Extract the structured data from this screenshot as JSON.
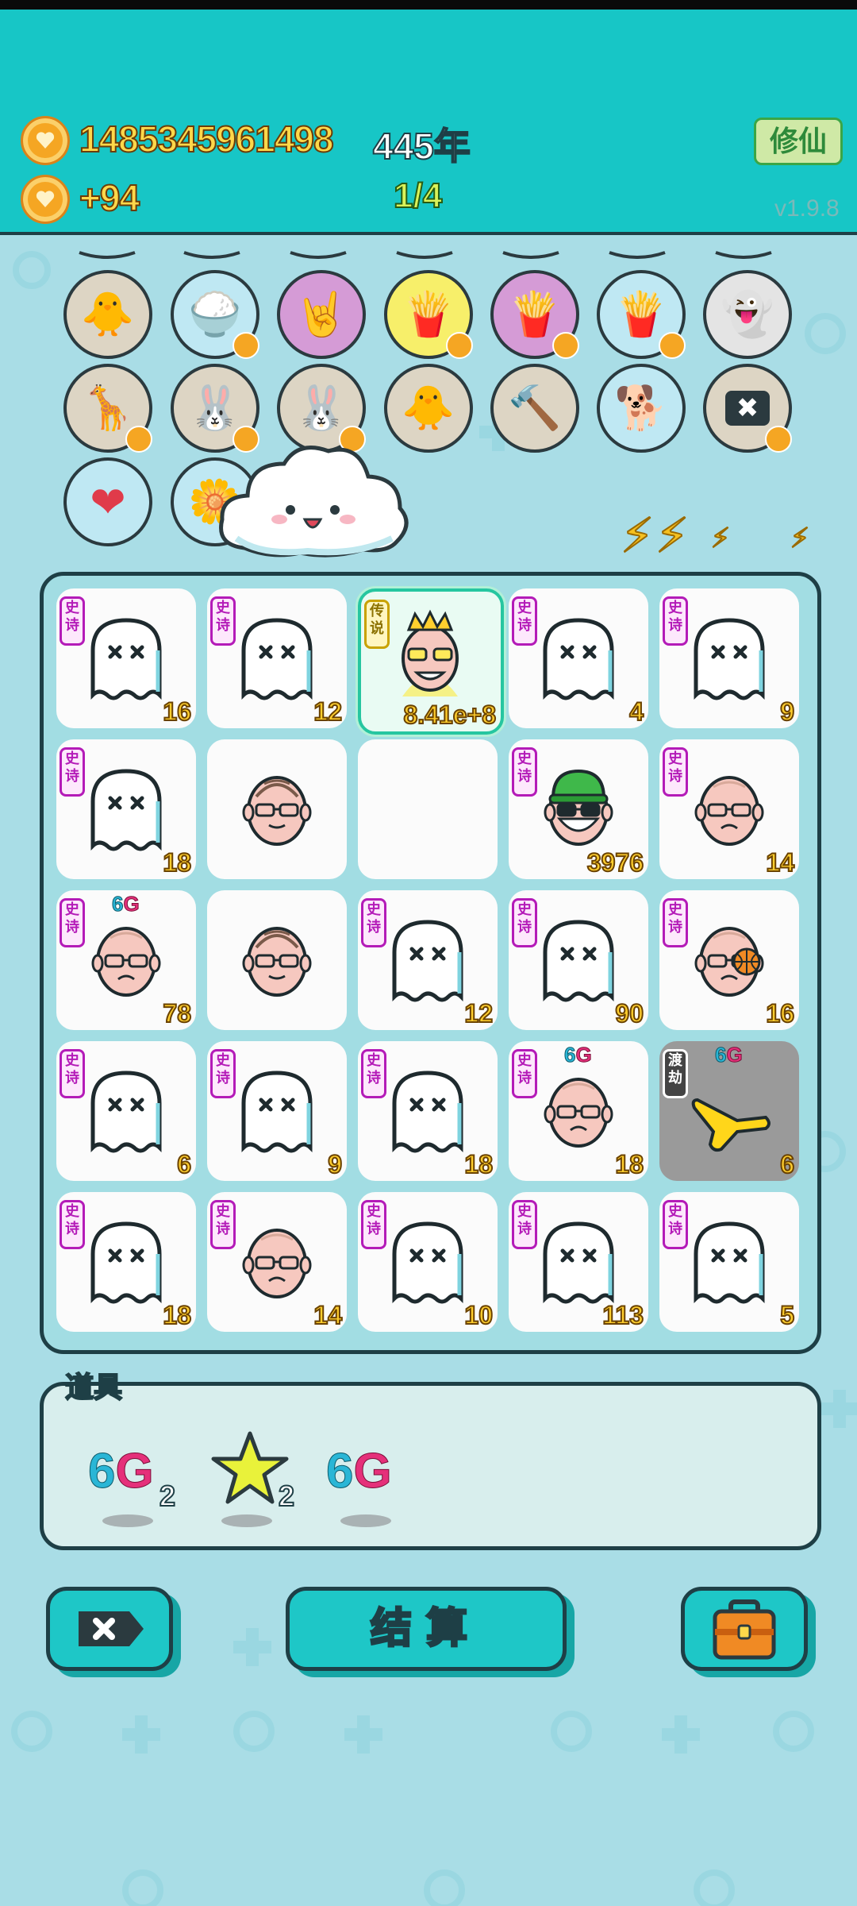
{
  "header": {
    "coins": "1485345961498",
    "years": "445年",
    "income": "+94",
    "progress": "1/4",
    "cultivate_button": "修仙",
    "version": "v1.9.8"
  },
  "units": [
    {
      "icon": "chick-icon",
      "bg": "#ddd5c4",
      "badge": false
    },
    {
      "icon": "rice-bowl-icon",
      "bg": "#bfe8f3",
      "badge": true
    },
    {
      "icon": "rock-hand-icon",
      "bg": "#d59bd6",
      "badge": false
    },
    {
      "icon": "fries-icon",
      "bg": "#f7ef6a",
      "badge": true
    },
    {
      "icon": "fries-icon",
      "bg": "#d59bd6",
      "badge": true
    },
    {
      "icon": "fries-icon",
      "bg": "#bfe8f3",
      "badge": true
    },
    {
      "icon": "ghost-icon",
      "bg": "#e4e4e4",
      "badge": false
    },
    {
      "icon": "giraffe-icon",
      "bg": "#ddd5c4",
      "badge": true
    },
    {
      "icon": "rabbit-icon",
      "bg": "#ddd5c4",
      "badge": true
    },
    {
      "icon": "rabbit-icon",
      "bg": "#ddd5c4",
      "badge": true
    },
    {
      "icon": "chick-icon",
      "bg": "#ddd5c4",
      "badge": false
    },
    {
      "icon": "hammer-icon",
      "bg": "#ddd5c4",
      "badge": false
    },
    {
      "icon": "dog-icon",
      "bg": "#bfe8f3",
      "badge": false
    },
    {
      "icon": "delete-icon",
      "bg": "#ddd5c4",
      "badge": true
    },
    {
      "icon": "heart-potion-icon",
      "bg": "#bfe8f3",
      "badge": false
    },
    {
      "icon": "flower-pot-icon",
      "bg": "#bfe8f3",
      "badge": false
    },
    {
      "icon": "lightning-icon",
      "bg": "#f7ef6a",
      "badge": false
    }
  ],
  "board": {
    "cells": [
      {
        "type": "ghost",
        "tag": "史诗",
        "value": "16"
      },
      {
        "type": "ghost",
        "tag": "史诗",
        "value": "12"
      },
      {
        "type": "king",
        "tag": "传说",
        "value": "8.41e+8",
        "selected": true
      },
      {
        "type": "ghost",
        "tag": "史诗",
        "value": "4"
      },
      {
        "type": "ghost",
        "tag": "史诗",
        "value": "9"
      },
      {
        "type": "ghost",
        "tag": "史诗",
        "value": "18"
      },
      {
        "type": "grandpa",
        "tag": "",
        "value": ""
      },
      {
        "type": "empty",
        "tag": "",
        "value": ""
      },
      {
        "type": "green_hat",
        "tag": "史诗",
        "value": "3976"
      },
      {
        "type": "old_man",
        "tag": "史诗",
        "value": "14"
      },
      {
        "type": "old_man",
        "tag": "史诗",
        "value": "78",
        "g6": true
      },
      {
        "type": "grandpa",
        "tag": "",
        "value": ""
      },
      {
        "type": "ghost",
        "tag": "史诗",
        "value": "12"
      },
      {
        "type": "ghost",
        "tag": "史诗",
        "value": "90"
      },
      {
        "type": "basketball_man",
        "tag": "史诗",
        "value": "16"
      },
      {
        "type": "ghost",
        "tag": "史诗",
        "value": "6"
      },
      {
        "type": "ghost",
        "tag": "史诗",
        "value": "9"
      },
      {
        "type": "ghost",
        "tag": "史诗",
        "value": "18"
      },
      {
        "type": "old_man",
        "tag": "史诗",
        "value": "18",
        "g6": true
      },
      {
        "type": "pointer",
        "tag": "渡劫",
        "value": "6",
        "g6": true,
        "gray": true
      },
      {
        "type": "ghost",
        "tag": "史诗",
        "value": "18"
      },
      {
        "type": "old_man",
        "tag": "史诗",
        "value": "14"
      },
      {
        "type": "ghost",
        "tag": "史诗",
        "value": "10"
      },
      {
        "type": "ghost",
        "tag": "史诗",
        "value": "113"
      },
      {
        "type": "ghost",
        "tag": "史诗",
        "value": "5"
      }
    ]
  },
  "g6_label": {
    "six": "6",
    "g": "G"
  },
  "items": {
    "title": "道具",
    "list": [
      {
        "icon": "6g-icon",
        "count": "2"
      },
      {
        "icon": "star-icon",
        "count": "2"
      },
      {
        "icon": "6g-icon",
        "count": ""
      }
    ]
  },
  "buttons": {
    "settle": "结算"
  }
}
